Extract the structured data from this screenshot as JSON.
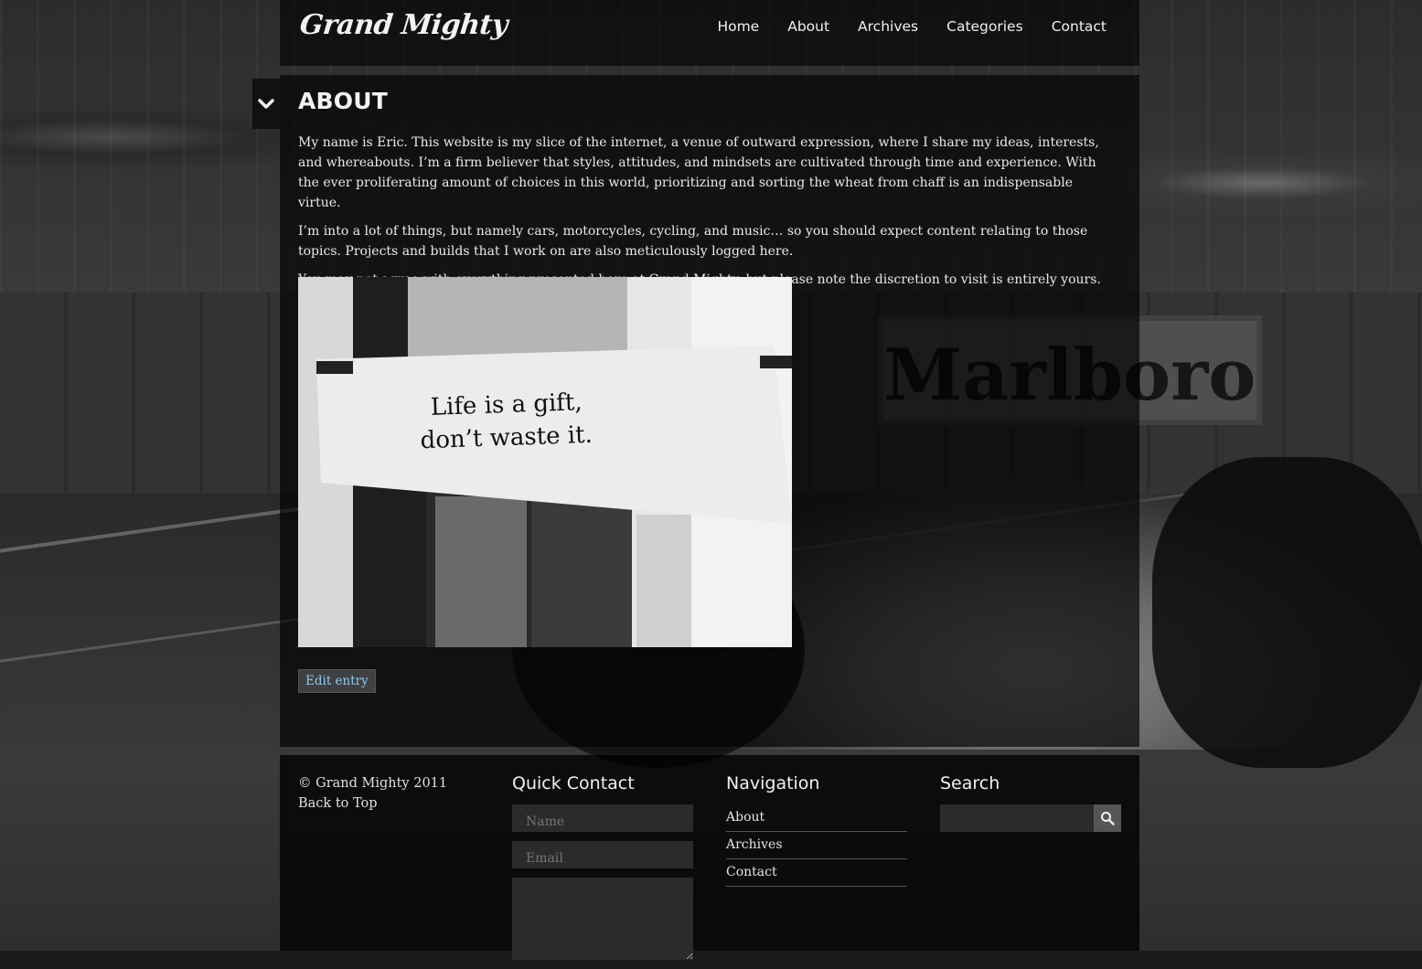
{
  "site": {
    "logo": "Grand Mighty",
    "nav": [
      "Home",
      "About",
      "Archives",
      "Categories",
      "Contact"
    ]
  },
  "page": {
    "title": "ABOUT",
    "paragraphs": [
      "My name is Eric. This website is my slice of the internet, a venue of outward expression, where I share my ideas, interests, and whereabouts. I’m a firm believer that styles, attitudes, and mindsets are cultivated through time and experience. With the ever proliferating amount of choices in this world, prioritizing and sorting the wheat from chaff is an indispensable virtue.",
      "I’m into a lot of things, but namely cars, motorcycles, cycling, and music… so you should expect content relating to those topics. Projects and builds that I work on are also meticulously logged here.",
      "You may not agree with everything presented here at Grand Mighty, but please note the discretion to visit is entirely yours."
    ],
    "photo_caption_lines": [
      "Life is a gift,",
      "don’t waste it."
    ],
    "edit_label": "Edit entry"
  },
  "background": {
    "banner_text": "Marlboro"
  },
  "footer": {
    "copyright": "© Grand Mighty 2011",
    "back_to_top": "Back to Top",
    "quick_contact": {
      "heading": "Quick Contact",
      "name_placeholder": "Name",
      "email_placeholder": "Email"
    },
    "navigation": {
      "heading": "Navigation",
      "items": [
        "About",
        "Archives",
        "Contact"
      ]
    },
    "search": {
      "heading": "Search",
      "icon": "search-icon"
    }
  }
}
